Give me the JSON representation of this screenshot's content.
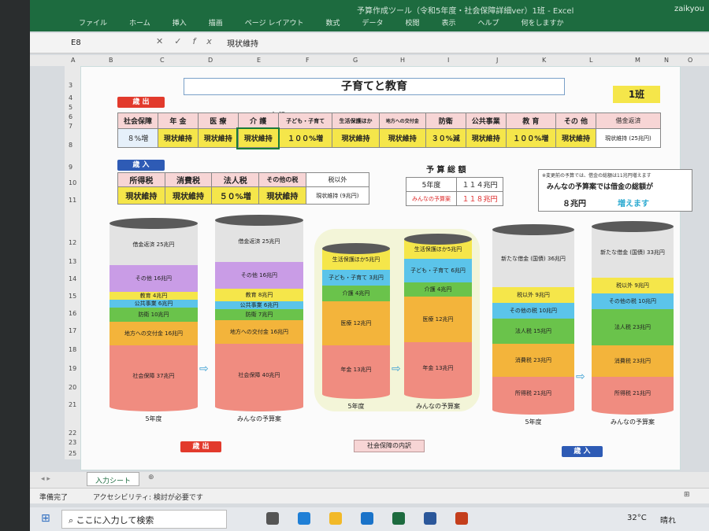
{
  "window": {
    "title": "予算作成ツール（令和5年度・社会保障詳細ver）1班 - Excel",
    "user": "zaikyou"
  },
  "ribbon": [
    "ファイル",
    "ホーム",
    "挿入",
    "描画",
    "ページ レイアウト",
    "数式",
    "データ",
    "校閲",
    "表示",
    "ヘルプ",
    "何をしますか"
  ],
  "namebox": "E8",
  "formula": "現状維持",
  "columns": [
    "A",
    "B",
    "C",
    "D",
    "E",
    "F",
    "G",
    "H",
    "I",
    "J",
    "K",
    "L",
    "M",
    "N",
    "O"
  ],
  "rows": [
    "3",
    "4",
    "5",
    "6",
    "7",
    "8",
    "9",
    "10",
    "11",
    "12",
    "13",
    "14",
    "15",
    "16",
    "17",
    "18",
    "19",
    "20",
    "21",
    "22",
    "23",
    "25"
  ],
  "sheet": {
    "title": "子育てと教育",
    "han": "1班",
    "saishutsu": "歳 出",
    "sainyu": "歳 入",
    "naiyaku": "内 訳",
    "exp_heads": [
      "社会保障",
      "年 金",
      "医 療",
      "介 護",
      "子ども・子育て",
      "生活保護ほか",
      "地方への交付金",
      "防衛",
      "公共事業",
      "教 育",
      "その 他",
      "借金返済"
    ],
    "exp_vals": [
      "８%増",
      "現状維持",
      "現状維持",
      "現状維持",
      "１００%増",
      "現状維持",
      "現状維持",
      "３０%減",
      "現状維持",
      "１００%増",
      "現状維持",
      "現状維持 (25兆円)"
    ],
    "rev_heads": [
      "所得税",
      "消費税",
      "法人税",
      "その他の税",
      "税以外"
    ],
    "rev_vals": [
      "現状維持",
      "現状維持",
      "５０%増",
      "現状維持",
      "現状維持 (9兆円)"
    ],
    "budget_title": "予 算 総 額",
    "budget_rows": [
      {
        "label": "5年度",
        "value": "１１４兆円"
      },
      {
        "label": "みんなの予算案",
        "value": "１１８兆円"
      }
    ],
    "note_small": "※変更前の予算では、借金の総額は11兆円増えます",
    "note_main": "みんなの予算案では借金の総額が",
    "note_amount": "８兆円",
    "note_change": "増えます",
    "cyl_labels": {
      "c1": "5年度",
      "c2": "みんなの予算案",
      "c3": "5年度",
      "c4": "みんなの予算案",
      "c5": "5年度",
      "c6": "みんなの予算案"
    },
    "c1": [
      "借金返済 25兆円",
      "その他 16兆円",
      "教育 4兆円",
      "公共事業 6兆円",
      "防衛 10兆円",
      "地方への交付金 16兆円",
      "社会保障 37兆円"
    ],
    "c2": [
      "借金返済 25兆円",
      "その他 16兆円",
      "教育 8兆円",
      "公共事業 6兆円",
      "防衛 7兆円",
      "地方への交付金 16兆円",
      "社会保障 40兆円"
    ],
    "c3": [
      "生活保護ほか5兆円",
      "子ども・子育て 3兆円",
      "介護 4兆円",
      "医療 12兆円",
      "年金 13兆円"
    ],
    "c4": [
      "生活保護ほか5兆円",
      "子ども・子育て 6兆円",
      "介護 4兆円",
      "医療 12兆円",
      "年金 13兆円"
    ],
    "c5": [
      "新たな借金 (国債) 36兆円",
      "税以外 9兆円",
      "その他の税 10兆円",
      "法人税 15兆円",
      "消費税 23兆円",
      "所得税 21兆円"
    ],
    "c6": [
      "新たな借金 (国債) 33兆円",
      "税以外 9兆円",
      "その他の税 10兆円",
      "法人税 23兆円",
      "消費税 23兆円",
      "所得税 21兆円"
    ],
    "btn_saishutsu": "歳 出",
    "btn_shakai": "社会保障の内訳",
    "btn_sainyu": "歳 入"
  },
  "sheettab": "入力シート",
  "status": {
    "ready": "準備完了",
    "access": "アクセシビリティ: 検討が必要です"
  },
  "taskbar": {
    "search": "ここに入力して検索",
    "temp": "32°C",
    "weather": "晴れ"
  },
  "colors": {
    "excel_green": "#1d6b3f",
    "pink": "#f7d5d5",
    "yellow": "#f5e64a",
    "red_tag": "#e23a2c",
    "blue_tag": "#2e5bb5"
  }
}
